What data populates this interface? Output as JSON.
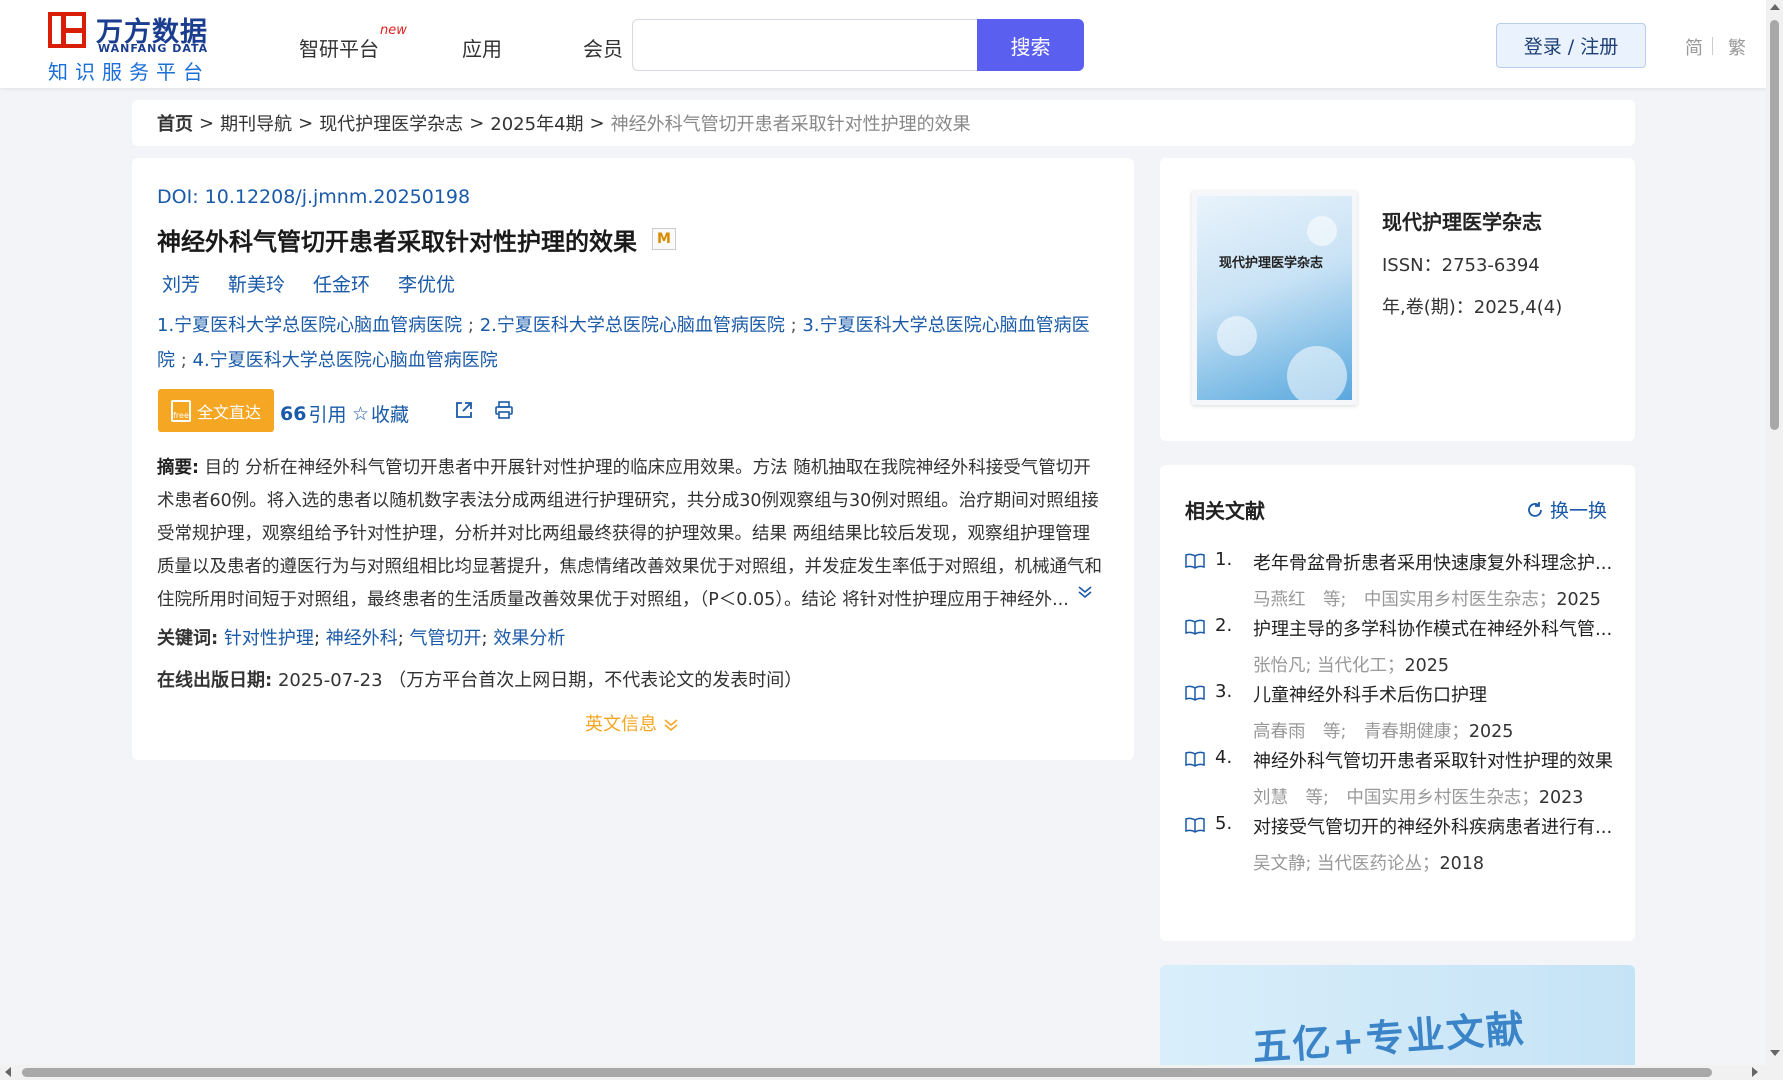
{
  "header": {
    "logo_cn": "万方数据",
    "logo_en": "WANFANG DATA",
    "logo_sub": "知识服务平台",
    "nav": [
      {
        "label": "智研平台",
        "badge": "new"
      },
      {
        "label": "应用"
      },
      {
        "label": "会员"
      }
    ],
    "search": {
      "placeholder": "",
      "value": "",
      "button_label": "搜索"
    },
    "login_label": "登录 / 注册",
    "lang_simplified": "简",
    "lang_traditional": "繁"
  },
  "breadcrumb": {
    "items": [
      "首页",
      "期刊导航",
      "现代护理医学杂志",
      "2025年4期"
    ],
    "current": "神经外科气管切开患者采取针对性护理的效果",
    "separator": ">"
  },
  "article": {
    "doi_label": "DOI:",
    "doi": "10.12208/j.jmnm.20250198",
    "title": "神经外科气管切开患者采取针对性护理的效果",
    "title_badge": "M",
    "authors": [
      "刘芳",
      "靳美玲",
      "任金环",
      "李优优"
    ],
    "affiliations": [
      "1.宁夏医科大学总医院心脑血管病医院",
      "2.宁夏医科大学总医院心脑血管病医院",
      "3.宁夏医科大学总医院心脑血管病医院",
      "4.宁夏医科大学总医院心脑血管病医院"
    ],
    "actions": {
      "fulltext": "全文直达",
      "free_tag": "free",
      "cite": "引用",
      "favorite": "收藏"
    },
    "abstract_label": "摘要:",
    "abstract": "目的 分析在神经外科气管切开患者中开展针对性护理的临床应用效果。方法 随机抽取在我院神经外科接受气管切开术患者60例。将入选的患者以随机数字表法分成两组进行护理研究，共分成30例观察组与30例对照组。治疗期间对照组接受常规护理，观察组给予针对性护理，分析并对比两组最终获得的护理效果。结果 两组结果比较后发现，观察组护理管理质量以及患者的遵医行为与对照组相比均显著提升，焦虑情绪改善效果优于对照组，并发症发生率低于对照组，机械通气和住院所用时间短于对照组，最终患者的生活质量改善效果优于对照组，（P＜0.05）。结论 将针对性护理应用于神经外...",
    "keywords_label": "关键词:",
    "keywords": [
      "针对性护理",
      "神经外科",
      "气管切开",
      "效果分析"
    ],
    "pubdate_label": "在线出版日期:",
    "pubdate": "2025-07-23",
    "pubdate_note": "（万方平台首次上网日期，不代表论文的发表时间）",
    "english_info": "英文信息"
  },
  "journal": {
    "cover_title": "现代护理医学杂志",
    "name": "现代护理医学杂志",
    "issn": "ISSN：2753-6394",
    "volume": "年,卷(期)：2025,4(4)"
  },
  "related": {
    "title": "相关文献",
    "refresh_label": "换一换",
    "items": [
      {
        "num": "1.",
        "title": "老年骨盆骨折患者采用快速康复外科理念护...",
        "meta": "马燕红　等;　中国实用乡村医生杂志；",
        "year": "2025"
      },
      {
        "num": "2.",
        "title": "护理主导的多学科协作模式在神经外科气管...",
        "meta": "张怡凡; 当代化工；",
        "year": "2025"
      },
      {
        "num": "3.",
        "title": "儿童神经外科手术后伤口护理",
        "meta": "高春雨　等;　青春期健康；",
        "year": "2025"
      },
      {
        "num": "4.",
        "title": "神经外科气管切开患者采取针对性护理的效果",
        "meta": "刘慧　等;　中国实用乡村医生杂志；",
        "year": "2023"
      },
      {
        "num": "5.",
        "title": "对接受气管切开的神经外科疾病患者进行有...",
        "meta": "吴文静; 当代医药论丛；",
        "year": "2018"
      }
    ]
  },
  "banner": {
    "text": "五亿+专业文献"
  },
  "colors": {
    "accent": "#5b5ff0",
    "link": "#1a5aa8",
    "orange": "#f5a623",
    "brand_red": "#d81e06"
  }
}
